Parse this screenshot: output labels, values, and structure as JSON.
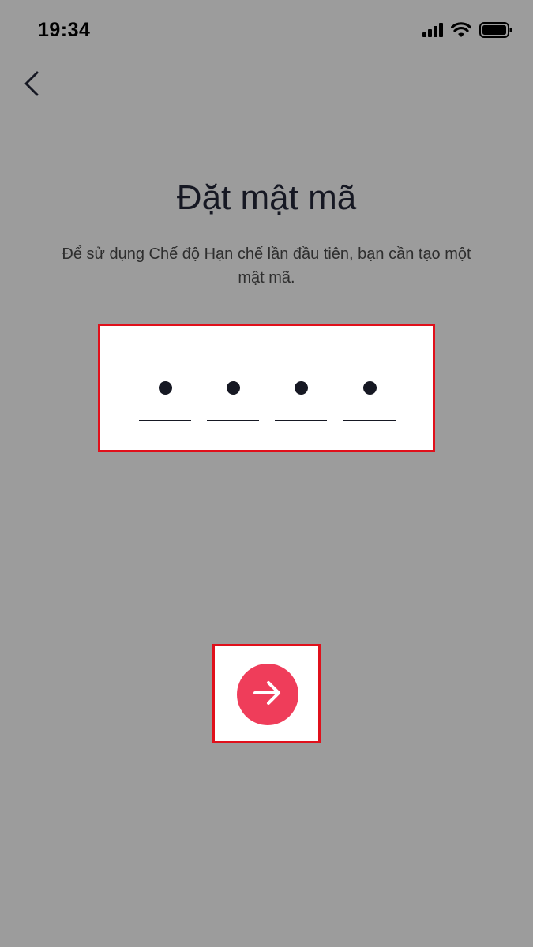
{
  "status_bar": {
    "time": "19:34",
    "icons": [
      "signal-icon",
      "wifi-icon",
      "battery-icon"
    ]
  },
  "header": {
    "back_icon": "chevron-left-icon"
  },
  "main": {
    "title": "Đặt mật mã",
    "subtitle": "Để sử dụng Chế độ Hạn chế lần đầu tiên, bạn cần tạo một mật mã.",
    "passcode": {
      "length": 4,
      "filled": 4
    },
    "next_icon": "arrow-right-icon"
  },
  "colors": {
    "background": "#9c9c9c",
    "accent": "#ef3d5a",
    "highlight_border": "#e0101b",
    "text_primary": "#161823"
  }
}
